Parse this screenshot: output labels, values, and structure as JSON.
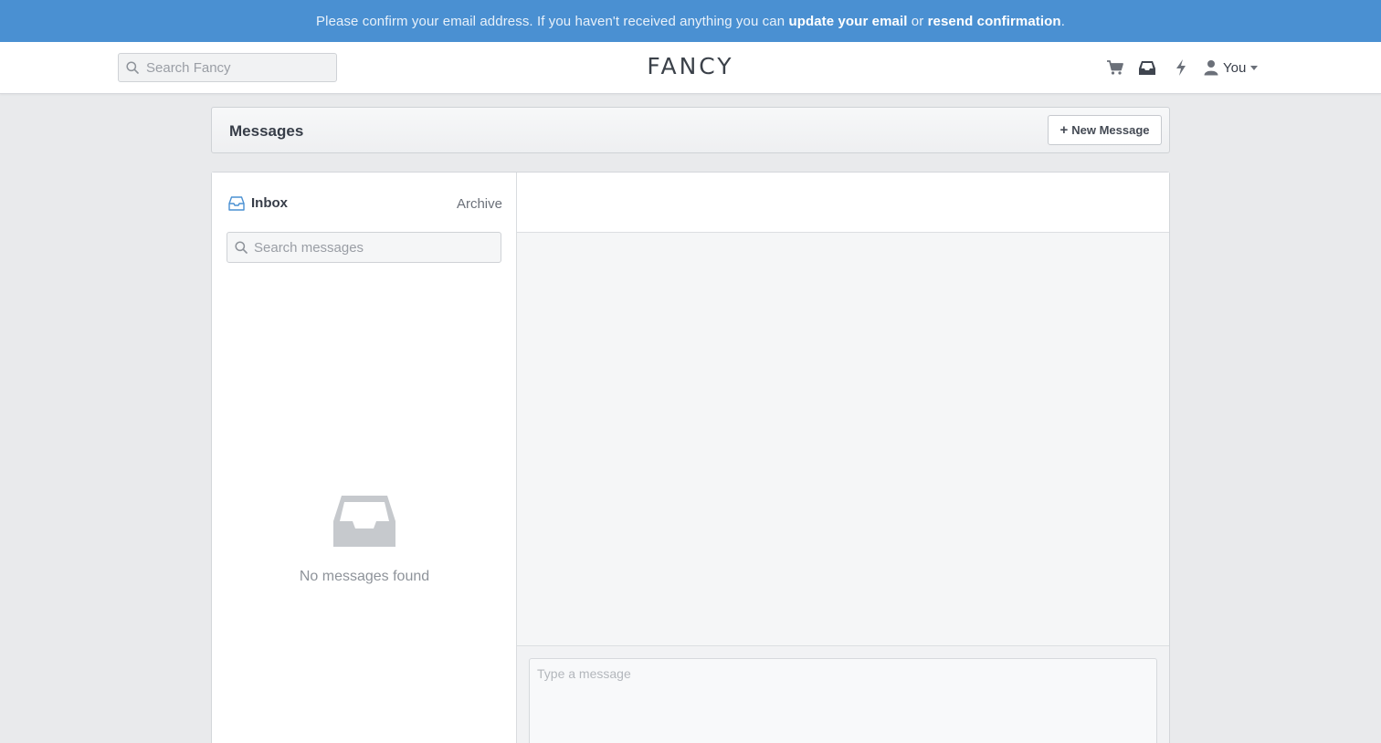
{
  "banner": {
    "text_before": "Please confirm your email address. If you haven't received anything you can ",
    "link_update": "update your email",
    "text_middle": " or ",
    "link_resend": "resend confirmation",
    "text_after": "."
  },
  "header": {
    "search_placeholder": "Search Fancy",
    "logo": "FANCY",
    "user_label": "You",
    "icons": [
      "cart-icon",
      "inbox-icon",
      "bolt-icon",
      "user-icon",
      "caret-down-icon"
    ]
  },
  "messages": {
    "title": "Messages",
    "new_message_plus": "+",
    "new_message_label": "New Message"
  },
  "sidebar": {
    "inbox_label": "Inbox",
    "archive_label": "Archive",
    "search_placeholder": "Search messages",
    "empty_text": "No messages found"
  },
  "composer": {
    "placeholder": "Type a message"
  },
  "colors": {
    "banner": "#4a90d2",
    "page_bg": "#e9eaec",
    "text": "#373d48"
  }
}
